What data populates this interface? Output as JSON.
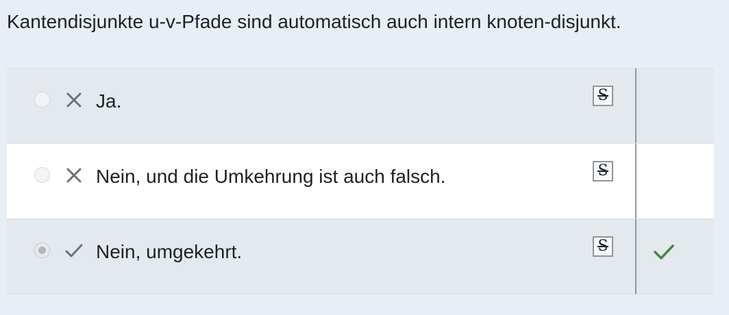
{
  "question": {
    "text": "Kantendisjunkte u-v-Pfade sind automatisch auch intern knoten-disjunkt."
  },
  "answers": [
    {
      "label": "Ja.",
      "mark": "x-icon",
      "selected": false,
      "correct": false,
      "strike_glyph": "S"
    },
    {
      "label": "Nein, und die Umkehrung ist auch falsch.",
      "mark": "x-icon",
      "selected": false,
      "correct": false,
      "strike_glyph": "S"
    },
    {
      "label": "Nein, umgekehrt.",
      "mark": "check-icon",
      "selected": true,
      "correct": true,
      "strike_glyph": "S"
    }
  ],
  "colors": {
    "page_background": "#e7eef5",
    "row_shaded": "#e3e9ed",
    "row_white": "#ffffff",
    "mark_gray": "#6a737b",
    "correct_green": "#3e8a3e",
    "text": "#1d2125"
  }
}
